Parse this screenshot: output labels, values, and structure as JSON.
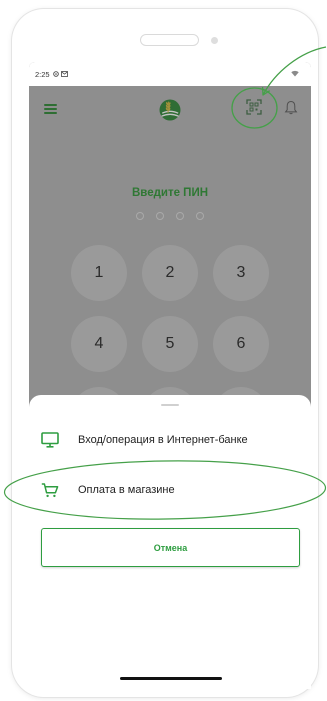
{
  "status_bar": {
    "time": "2:25",
    "left_icons": [
      "settings-icon",
      "mail-icon"
    ],
    "right_icons": [
      "wifi-icon"
    ]
  },
  "header": {
    "menu_icon": "hamburger-menu-icon",
    "logo_icon": "bank-logo-icon",
    "scan_icon": "qr-scan-icon",
    "notifications_icon": "bell-icon"
  },
  "pin": {
    "prompt": "Введите ПИН",
    "length": 4,
    "entered": 0
  },
  "keypad": {
    "rows": [
      [
        "1",
        "2",
        "3"
      ],
      [
        "4",
        "5",
        "6"
      ]
    ]
  },
  "sheet": {
    "options": [
      {
        "icon": "monitor-icon",
        "label": "Вход/операция в Интернет-банке"
      },
      {
        "icon": "cart-icon",
        "label": "Оплата в магазине"
      }
    ],
    "cancel_label": "Отмена"
  },
  "annotations": {
    "color": "#45a049"
  },
  "colors": {
    "brand_green": "#2e9d40",
    "dimmed_background": "#8e8e8e",
    "dimmed_green": "#2f7834",
    "text": "#222222"
  }
}
